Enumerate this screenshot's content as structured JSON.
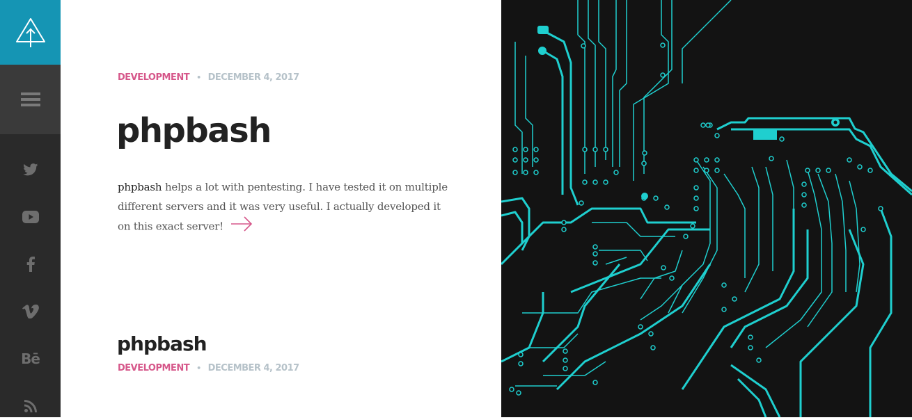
{
  "colors": {
    "sidebar_bg": "#2a2a2a",
    "logo_bg": "#1595b4",
    "menu_bg": "#3a3a3a",
    "accent_pink": "#d6578a",
    "meta_gray": "#b6c2c9",
    "circuit": "#1fcfcf",
    "hero_bg": "#131313"
  },
  "sidebar": {
    "logo_icon": "tree-upload-icon",
    "menu_icon": "hamburger-menu-icon",
    "social": [
      {
        "icon": "twitter-icon"
      },
      {
        "icon": "youtube-icon"
      },
      {
        "icon": "facebook-icon"
      },
      {
        "icon": "vimeo-icon"
      },
      {
        "icon": "behance-icon",
        "glyph": "Bē"
      },
      {
        "icon": "rss-icon"
      }
    ]
  },
  "featured_post": {
    "category": "DEVELOPMENT",
    "separator": "•",
    "date": "DECEMBER 4, 2017",
    "title": "phpbash",
    "excerpt_strong": "phpbash",
    "excerpt_rest": " helps a lot with pentesting. I have tested it on multiple different servers and it was very useful. I actually developed it on this exact server!",
    "read_more_icon": "arrow-right-icon"
  },
  "second_post": {
    "title": "phpbash",
    "category": "DEVELOPMENT",
    "separator": "•",
    "date": "DECEMBER 4, 2017"
  },
  "hero": {
    "image": "circuit-board-image"
  }
}
